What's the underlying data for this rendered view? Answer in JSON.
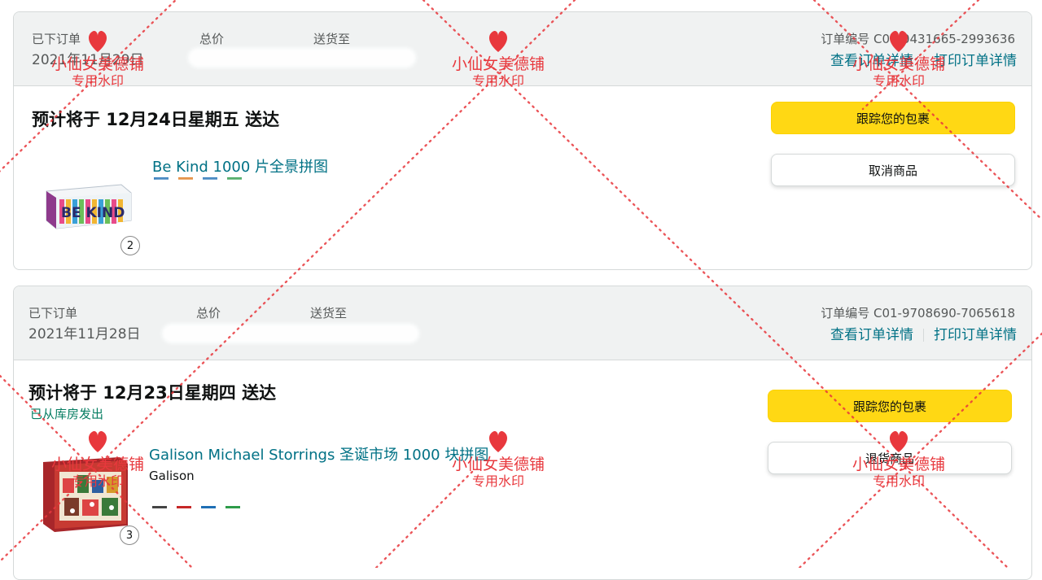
{
  "labels": {
    "placed": "已下订单",
    "total": "总价",
    "ship_to": "送货至",
    "order_no_prefix": "订单编号",
    "view_details": "查看订单详情",
    "print_details": "打印订单详情",
    "track": "跟踪您的包裹"
  },
  "orders": [
    {
      "placed_date": "2021年11月29日",
      "order_no": "C01-0431665-2993636",
      "eta": "预计将于 12月24日星期五 送达",
      "secondary_button": "取消商品",
      "product_title": "Be Kind 1000 片全景拼图",
      "quantity": "2",
      "thumb_text": "BE KIND"
    },
    {
      "placed_date": "2021年11月28日",
      "order_no": "C01-9708690-7065618",
      "eta": "预计将于 12月23日星期四 送达",
      "status": "已从库房发出",
      "secondary_button": "退货商品",
      "product_title": "Galison Michael Storrings 圣诞市场 1000 块拼图",
      "brand": "Galison",
      "quantity": "3"
    }
  ],
  "watermark": {
    "line1": "小仙女美德铺",
    "line2": "专用水印",
    "color": "#e8383d"
  },
  "colors": {
    "link": "#007185",
    "header_bg": "#f0f2f2",
    "track_button": "#ffd814",
    "shipped": "#067d62"
  }
}
